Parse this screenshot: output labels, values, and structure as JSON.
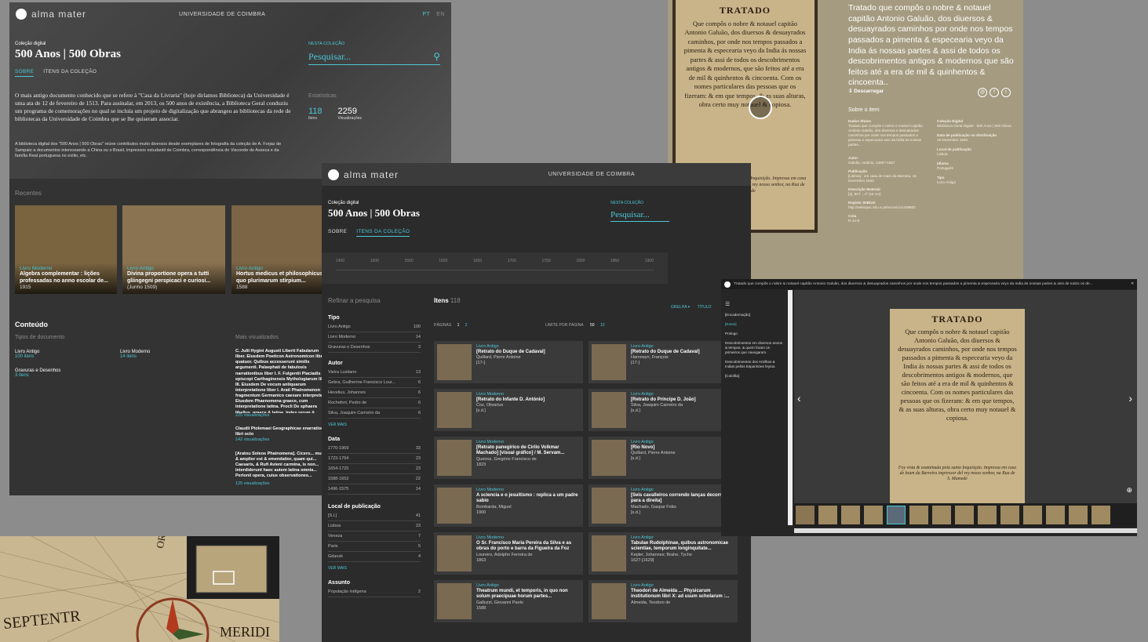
{
  "brand": "alma mater",
  "university": "UNIVERSIDADE DE COIMBRA",
  "lang": {
    "pt": "PT",
    "en": "EN"
  },
  "collection": {
    "label": "Coleção digital",
    "title": "500 Anos | 500 Obras"
  },
  "tabs": {
    "about": "SOBRE",
    "items": "ITENS DA COLEÇÃO"
  },
  "search": {
    "label": "NESTA COLEÇÃO",
    "placeholder": "Pesquisar..."
  },
  "about_text": "O mais antigo documento conhecido que se refere à \"Casa da Livraria\" (hoje diríamos Biblioteca) da Universidade é uma ata de 12 de fevereiro de 1513. Para assinalar, em 2013, os 500 anos de existência, a Biblioteca Geral conduziu um programa de comemorações no qual se incluía um projeto de digitalização que abrangeu as bibliotecas da rede de bibliotecas da Universidade de Coimbra que se lhe quiseram associar.",
  "about_text2": "A biblioteca digital dos \"500 Anos | 500 Obras\" reúne contributos muito diversos desde exemplares de fotografia da coleção de A. Forjaz de Sampaio a documentos interessando a China ou o Brasil, impressos estudantil de Coimbra, correspondência do Visconde de Asseca e da família Real portuguesa no exílio, etc.",
  "stats": {
    "label": "Estatísticas",
    "items": "118",
    "items_label": "Itens",
    "views": "2259",
    "views_label": "Visualizações"
  },
  "recent": {
    "label": "Recentes",
    "items": [
      {
        "type": "Livro Moderno",
        "title": "Algebra complementar : lições professadas no anno escolar de...",
        "date": "1915"
      },
      {
        "type": "Livro Antigo",
        "title": "Divina proportione opera a tutti gliingegni perspicaci e curiosi...",
        "date": "(Junho 1509)"
      },
      {
        "type": "Livro Antigo",
        "title": "Hortus medicus et philosophicus in quo plurimarum stirpium...",
        "date": "1588"
      }
    ]
  },
  "content": {
    "label": "Conteúdo",
    "types_label": "Tipos de documento",
    "types": [
      {
        "name": "Livro Antigo",
        "count": "100 itens"
      },
      {
        "name": "Livro Moderno",
        "count": "14 itens"
      },
      {
        "name": "Gravuras e Desenhos",
        "count": "3 itens"
      }
    ],
    "most_viewed_label": "Mais visualizados",
    "most_viewed": [
      {
        "text": "C. Julii Hygini Augusti Liberti Fabularum liber. Eiusdem Poeticon Astronomicon libri quatuor. Quibus accesserunt similis argumenti. Palaephati de fabulosis narrationibus liber I. F. Fulgentii Placiadis episcopi Carthaginensis Mythologiarum libri III. Eiusdem De vocum antiquarum interpretatione liber I. Arati Phainomenon fragmentum Germanico caesare interprete. Eiusdem Phaenomena graece, cum interpretatione latina. Procli De sphaera libellus, graece & latine. Index rerum & fabularum in his omnibus scitu dignarum copiosissimus",
        "views": "225 visualizações"
      },
      {
        "text": "Claudii Ptolemaei Geographicae enarrationis libri octo",
        "views": "142 visualizações"
      },
      {
        "text": "[Aratou Soleos Phainomena]. Cicero... multo & amplior est & emendatior, quam qui... Caesaris, & Rufi Avieni carmina, is non... interdiderunt haec autem latina omnia... Perionii opera, cuius observationes...",
        "views": "125 visualizações"
      }
    ]
  },
  "timeline": [
    "1400",
    "1500",
    "1550",
    "1600",
    "1650",
    "1700",
    "1750",
    "1800",
    "1850",
    "1900"
  ],
  "refine": "Refinar a pesquisa",
  "items_header": {
    "label": "Itens",
    "count": "118"
  },
  "pagination": {
    "label": "PÁGINAS",
    "p1": "1",
    "p2": "2",
    "limit": "LIMITE POR PÁGINA",
    "l1": "50",
    "l2": "10"
  },
  "view": {
    "grid": "GRELHA",
    "title": "TÍTULO"
  },
  "facets": {
    "tipo": {
      "label": "Tipo",
      "rows": [
        [
          "Livro Antigo",
          "100"
        ],
        [
          "Livro Moderno",
          "14"
        ],
        [
          "Gravuras e Desenhos",
          "3"
        ]
      ]
    },
    "autor": {
      "label": "Autor",
      "rows": [
        [
          "Vieira Lusitano",
          "13"
        ],
        [
          "Gebra, Guilherme Francisco Lour...",
          "6"
        ],
        [
          "Hevelius, Johannes",
          "6"
        ],
        [
          "Rochefort, Pedro de",
          "6"
        ],
        [
          "Silva, Joaquim Carneiro da",
          "6"
        ]
      ],
      "more": "VER MAIS"
    },
    "data": {
      "label": "Data",
      "rows": [
        [
          "1770-1969",
          "33"
        ],
        [
          "1723-1764",
          "23"
        ],
        [
          "1654-1720",
          "23"
        ],
        [
          "1588-1653",
          "22"
        ],
        [
          "1496-1575",
          "14"
        ]
      ]
    },
    "local": {
      "label": "Local de publicação",
      "rows": [
        [
          "[S.l.]",
          "41"
        ],
        [
          "Lisboa",
          "23"
        ],
        [
          "Veneza",
          "7"
        ],
        [
          "Paris",
          "5"
        ],
        [
          "Gdansk",
          "4"
        ]
      ],
      "more": "VER MAIS"
    },
    "assunto": {
      "label": "Assunto",
      "rows": [
        [
          "População indígena",
          "2"
        ]
      ]
    }
  },
  "cards": [
    {
      "type": "Livro Antigo",
      "title": "[Retrato do Duque de Cadaval]",
      "author": "Quillard, Pierre Antoine",
      "date": "[17-]"
    },
    {
      "type": "Livro Antigo",
      "title": "[Retrato do Duque de Cadaval]",
      "author": "Harrewyn, François",
      "date": "[17-]"
    },
    {
      "type": "Livro Moderno",
      "title": "[Retrato do Infante D. António]",
      "author": "Coz, Olivarius",
      "date": "[s.d.]"
    },
    {
      "type": "Livro Antigo",
      "title": "[Retrato do Príncipe D. João]",
      "author": "Silva, Joaquim Carneiro da",
      "date": "[s.d.]"
    },
    {
      "type": "Livro Moderno",
      "title": "[Retrato panegírico de Cirilo Volkmar Machado] [visual gráfico] / M. Servam...",
      "author": "Queiroz, Gregório Francisco de",
      "date": "1823"
    },
    {
      "type": "Livro Antigo",
      "title": "[Rio Novo]",
      "author": "Quillard, Pierre Antoine",
      "date": "[s.d.]"
    },
    {
      "type": "Livro Moderno",
      "title": "A sciencia e o jesuitismo : replica a um padre sabio",
      "author": "Bombarda, Miguel",
      "date": "1900"
    },
    {
      "type": "Livro Antigo",
      "title": "[Seis cavalleiros correndo lanças decorrendo para a direita]",
      "author": "Machado, Gaspar Frião",
      "date": "[s.d.]"
    },
    {
      "type": "Livro Moderno",
      "title": "O Sr. Francisco Maria Pereira da Silva e as obras do porto e barra da Figueira da Foz",
      "author": "Loureiro, Adolpho Ferreira de",
      "date": "1863"
    },
    {
      "type": "Livro Antigo",
      "title": "Tabulae Rudolphinae, quibus astronomicae scientiae, temporum longinquitate...",
      "author": "Kepler, Johannes; Brahe, Tycho",
      "date": "1627-[1629]"
    },
    {
      "type": "Livro Antigo",
      "title": "Theatrum mundi, et temporis, in quo non solum praecipuae horum partes...",
      "author": "Galluzzi, Giovanni Paolo",
      "date": "1588"
    },
    {
      "type": "Livro Antigo",
      "title": "Theodori de Almeida ... Physicarum institutionum libri X: ad usum scholarum :...",
      "author": "Almeida, Teodoro de",
      "date": ""
    }
  ],
  "item": {
    "page_title": "TRATADO",
    "page_text": "Que compôs o nobre & notauel capitão Antonio Galuão, dos diuersos & desuayrados caminhos, por onde nos tempos passados a pimenta & especearia veyo da India ás nossas partes & assi de todos os descobrimentos antigos & modernos, que são feitos até a era de mil & quinhentos & cincoenta. Com os nomes particulares das pessoas que os fizeram: & em que tempos, & as suas alturas, obra certo muy notauel & copiosa.",
    "page_foot": "Foy vista & examinada pola santa Inquisição. Impressa em casa de Ioam da Barreira impressor del rey nosso senhor, na Rua de S. Mamede",
    "heading": "Tratado que compôs o nobre & notauel capitão Antonio Galuão, dos diuersos & desuayrados caminhos por onde nos tempos passados a pimenta & especearia veyo da India ás nossas partes & assi de todos os descobrimentos antigos & modernos que são feitos até a era de mil & quinhentos & cincoenta..",
    "download": "Descarregar",
    "about": "Sobre o item",
    "fields": [
      [
        "Dados títulos",
        "Tratado que compôs o nobre e notável capitão António Galvão, dos diversos e desvairados caminhos por onde nos tempos passados a pimenta e especearia veio da Índia às nossas partes..."
      ],
      [
        "Autor",
        "Galvão, António, 1490?-1557"
      ],
      [
        "Publicação",
        "[Lisboa] : em casa de Ioam da Barreira, 15 Dezembro 1563"
      ],
      [
        "Descrição Material",
        "[4], 80 f. ; 4º (19 cm)"
      ],
      [
        "Registo SIIB/UC",
        "http://webopac.sib.uc.pt/record=b1208800"
      ],
      [
        "Cota",
        "R-14-8"
      ]
    ],
    "fields2": [
      [
        "Coleção Digital",
        "Biblioteca Geral Digital · 500 Anos | 500 Obras"
      ],
      [
        "Data de publicação ou distribuição",
        "15 Dezembro 1563"
      ],
      [
        "Local de publicação",
        "Lisboa"
      ],
      [
        "Idioma",
        "Português"
      ],
      [
        "Tipo",
        "Livro Antigo"
      ]
    ]
  },
  "viewer": {
    "title": "Tratado que compôs o nobre & notauel capitão Antonio Galuão, dos diuersos & desuayrados caminhos por onde nos tempos passados a pimenta & especearia veyo da India ás nossas partes & assi de todos os de...",
    "toc": [
      "[Encadernação]",
      "[Rosto]",
      "Prologo",
      "Descobrimentos em diversos annos & tempos, & quem foram os primeiros que navegaram.",
      "Descobrimentos dos Antilhas & Indias pellos Espanhóes feytos.",
      "[Colofão]"
    ]
  },
  "map": {
    "words": [
      "SEPTENTR",
      "MERIDI",
      "ORIENS"
    ]
  }
}
